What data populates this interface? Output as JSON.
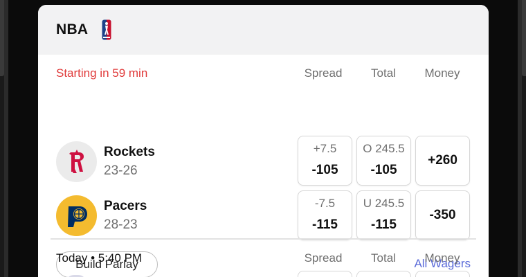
{
  "league": {
    "name": "NBA",
    "logo_icon": "nba-logo-icon"
  },
  "columns": {
    "spread": "Spread",
    "total": "Total",
    "money": "Money"
  },
  "game1": {
    "status": "Starting in 59 min",
    "status_color": "#e03a3a",
    "teams": [
      {
        "name": "Rockets",
        "record": "23-26",
        "logo_icon": "rockets-logo-icon",
        "spread": {
          "line": "+7.5",
          "price": "-105"
        },
        "total": {
          "line": "O 245.5",
          "price": "-105"
        },
        "money": "+260"
      },
      {
        "name": "Pacers",
        "record": "28-23",
        "logo_icon": "pacers-logo-icon",
        "spread": {
          "line": "-7.5",
          "price": "-115"
        },
        "total": {
          "line": "U 245.5",
          "price": "-115"
        },
        "money": "-350"
      }
    ],
    "build_parlay_label": "Build Parlay",
    "all_wagers_label": "All Wagers",
    "link_color": "#5a6ad8"
  },
  "game2": {
    "time": "Today • 5:40 PM"
  }
}
